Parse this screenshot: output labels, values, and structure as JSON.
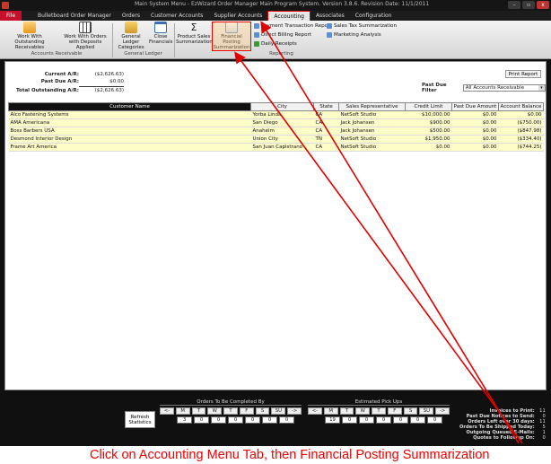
{
  "window": {
    "title": "Main System Menu - EzWizard Order Manager Main Program System. Version 3.8.6. Revision Date: 11/1/2011",
    "buttons": [
      "–",
      "▫",
      "x"
    ]
  },
  "menu_tabs": [
    "File",
    "Bulletboard Order Manager",
    "Orders",
    "Customer Accounts",
    "Supplier Accounts",
    "Accounting",
    "Associates",
    "Configuration"
  ],
  "active_tab": "Accounting",
  "ribbon": {
    "ar": {
      "btn1": [
        "Work With Outstanding",
        "Receivables"
      ],
      "btn2": [
        "Work With Orders",
        "with Deposits Applied"
      ],
      "group": "Accounts Receivable"
    },
    "gl": {
      "btn1": [
        "General Ledger",
        "Categories"
      ],
      "btn2": [
        "Close",
        "Financials"
      ],
      "group": "General Ledger"
    },
    "rep": {
      "btn1": [
        "Product Sales",
        "Summarization"
      ],
      "btn2": [
        "Financial Posting",
        "Summarization"
      ],
      "small": [
        "Payment Transaction Report",
        "Direct Billing Report",
        "Daily Receipts",
        "Sales Tax Summarization",
        "Marketing Analysis"
      ],
      "group": "Reporting"
    }
  },
  "summary": {
    "current_label": "Current A/R:",
    "current": "($2,626.63)",
    "pastdue_label": "Past Due A/R:",
    "pastdue": "$0.00",
    "total_label": "Total Outstanding A/R:",
    "total": "($2,626.63)"
  },
  "print_label": "Print Report",
  "filter": {
    "label": "Past Due Filter",
    "value": "All Accounts Receivable"
  },
  "table": {
    "columns": [
      "Customer Name",
      "City",
      "State",
      "Sales Representative",
      "Credit Limit",
      "Past Due Amount",
      "Account Balance"
    ],
    "rows": [
      [
        "Alco Fastening Systems",
        "Yorba Linda",
        "CA",
        "NetSoft Studio",
        "$10,000.00",
        "$0.00",
        "$0.00"
      ],
      [
        "AMA Americana",
        "San Diego",
        "CA",
        "Jack Johansen",
        "$900.00",
        "$0.00",
        "($750.00)"
      ],
      [
        "Boss Barbers USA",
        "Anaheim",
        "CA",
        "Jack Johansen",
        "$500.00",
        "$0.00",
        "($847.98)"
      ],
      [
        "Desmond Interior Design",
        "Union City",
        "TN",
        "NetSoft Studio",
        "$1,950.00",
        "$0.00",
        "($334.40)"
      ],
      [
        "Frame Art America",
        "San Juan Capistrano",
        "CA",
        "NetSoft Studio",
        "$0.00",
        "$0.00",
        "($744.25)"
      ]
    ]
  },
  "bottom": {
    "refresh": [
      "Refresh",
      "Statistics"
    ],
    "orders": {
      "title": "Orders To Be Completed By",
      "days": [
        "<-",
        "M",
        "T",
        "W",
        "T",
        "F",
        "S",
        "SU",
        "->"
      ],
      "counts": [
        "",
        "3",
        "0",
        "0",
        "0",
        "0",
        "0",
        "0",
        ""
      ]
    },
    "pickup": {
      "title": "Estimated Pick Ups",
      "days": [
        "<-",
        "M",
        "T",
        "W",
        "T",
        "F",
        "S",
        "SU",
        "->"
      ],
      "counts": [
        "",
        "19",
        "0",
        "0",
        "0",
        "0",
        "0",
        "0",
        ""
      ]
    },
    "stats": [
      [
        "Invoices to Print:",
        "11"
      ],
      [
        "Past Due Notices to Send:",
        "0"
      ],
      [
        "Orders Left over 30 days:",
        "11"
      ],
      [
        "Orders To Be Shipped Today:",
        "5"
      ],
      [
        "Outgoing Queued E-Mails:",
        "1"
      ],
      [
        "Quotes to Followup On:",
        "0"
      ]
    ]
  },
  "caption": "Click on Accounting Menu Tab, then Financial Posting Summarization",
  "colors": {
    "annotation": "#e00000",
    "row_bg": "#fdfdc8",
    "file_tab": "#c8102e"
  }
}
